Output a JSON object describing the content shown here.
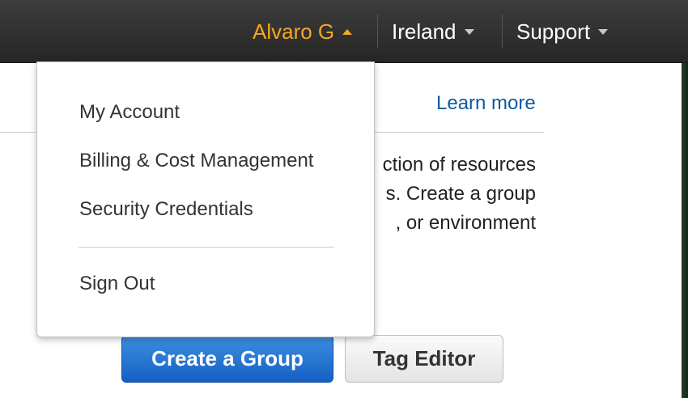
{
  "header": {
    "user_label": "Alvaro G",
    "region_label": "Ireland",
    "support_label": "Support"
  },
  "user_menu": {
    "items": [
      {
        "label": "My Account"
      },
      {
        "label": "Billing & Cost Management"
      },
      {
        "label": "Security Credentials"
      }
    ],
    "sign_out_label": "Sign Out"
  },
  "main": {
    "learn_more": "Learn more",
    "lines": [
      "ction of resources",
      "s. Create a group",
      ", or environment"
    ],
    "create_group_label": "Create a Group",
    "tag_editor_label": "Tag Editor"
  },
  "colors": {
    "topbar": "#2f2f2f",
    "user_accent": "#f5a623",
    "link": "#0b5a9e",
    "primary_button": "#1f6fd0"
  },
  "icons": [
    "chevron-up-icon",
    "chevron-down-icon"
  ]
}
